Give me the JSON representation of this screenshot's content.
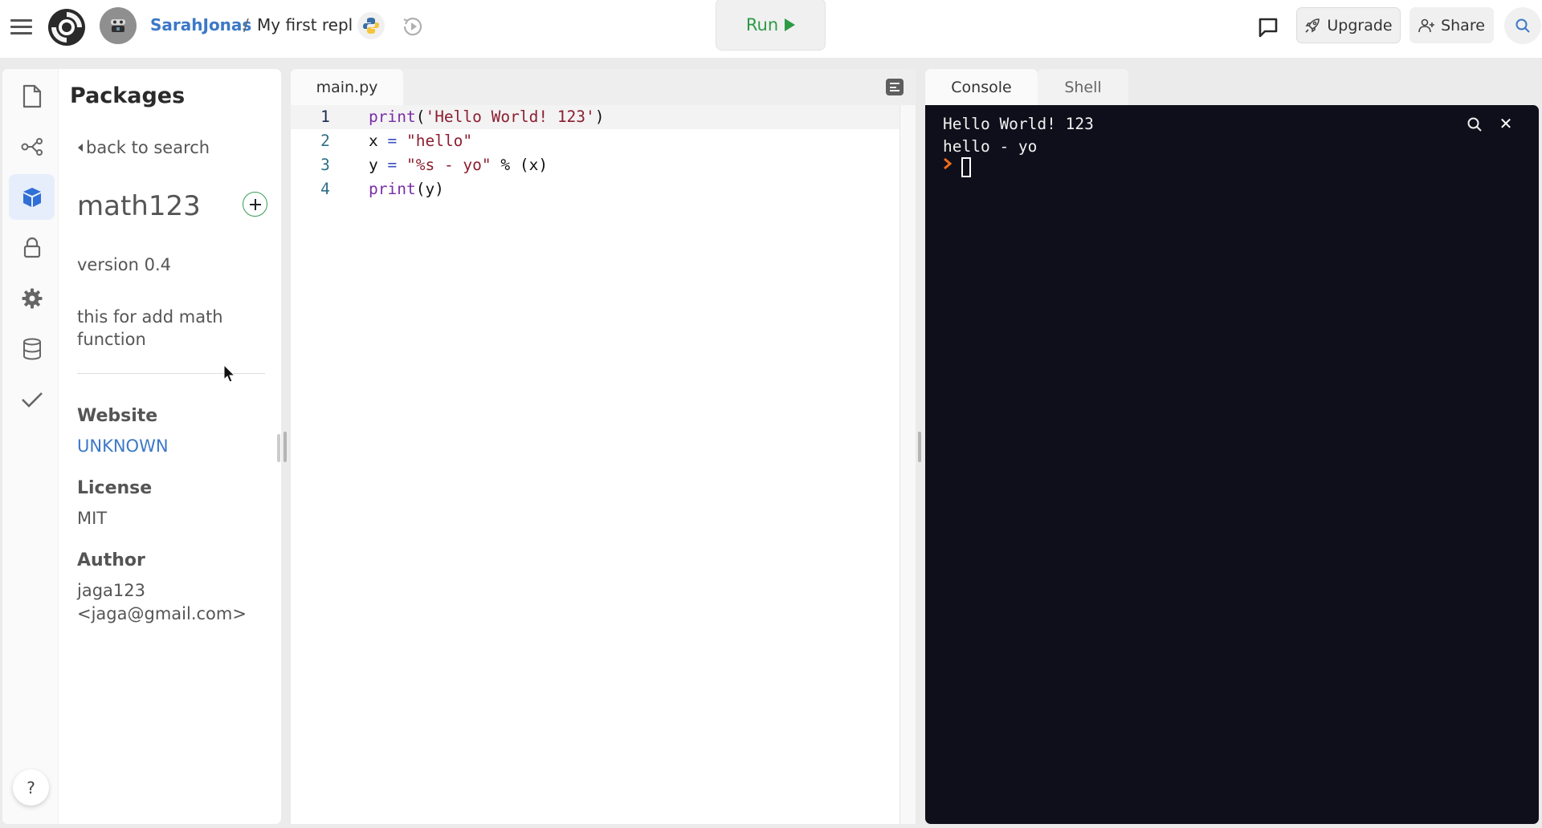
{
  "header": {
    "user": "SarahJonas",
    "separator": "/",
    "repl_name": "My first repl",
    "language_icon": "python-icon",
    "run_label": "Run",
    "upgrade_label": "Upgrade",
    "share_label": "Share"
  },
  "sidebar": {
    "items": [
      {
        "name": "files",
        "icon": "file-icon",
        "active": false
      },
      {
        "name": "version-control",
        "icon": "share-nodes-icon",
        "active": false
      },
      {
        "name": "packages",
        "icon": "cube-icon",
        "active": true
      },
      {
        "name": "secrets",
        "icon": "lock-icon",
        "active": false
      },
      {
        "name": "settings",
        "icon": "gear-icon",
        "active": false
      },
      {
        "name": "database",
        "icon": "database-icon",
        "active": false
      },
      {
        "name": "unit-tests",
        "icon": "check-icon",
        "active": false
      }
    ],
    "help_label": "?"
  },
  "packages": {
    "title": "Packages",
    "back_label": "back to search",
    "name": "math123",
    "version": "version 0.4",
    "description": "this for add math function",
    "website_label": "Website",
    "website_value": "UNKNOWN",
    "license_label": "License",
    "license_value": "MIT",
    "author_label": "Author",
    "author_name": "jaga123",
    "author_email": "<jaga@gmail.com>"
  },
  "editor": {
    "tab_label": "main.py",
    "lines": [
      {
        "number": "1",
        "tokens": [
          {
            "t": "print",
            "c": "kw"
          },
          {
            "t": "(",
            "c": ""
          },
          {
            "t": "'Hello World! 123'",
            "c": "str"
          },
          {
            "t": ")",
            "c": ""
          }
        ]
      },
      {
        "number": "2",
        "tokens": [
          {
            "t": "x ",
            "c": ""
          },
          {
            "t": "=",
            "c": "op"
          },
          {
            "t": " ",
            "c": ""
          },
          {
            "t": "\"hello\"",
            "c": "str"
          }
        ]
      },
      {
        "number": "3",
        "tokens": [
          {
            "t": "y ",
            "c": ""
          },
          {
            "t": "=",
            "c": "op"
          },
          {
            "t": " ",
            "c": ""
          },
          {
            "t": "\"%s - yo\"",
            "c": "str"
          },
          {
            "t": " % (x)",
            "c": ""
          }
        ]
      },
      {
        "number": "4",
        "tokens": [
          {
            "t": "print",
            "c": "kw"
          },
          {
            "t": "(y)",
            "c": ""
          }
        ]
      }
    ]
  },
  "console": {
    "tabs": [
      "Console",
      "Shell"
    ],
    "active_tab": "Console",
    "output": [
      "Hello World! 123",
      "hello - yo"
    ]
  },
  "colors": {
    "accent_blue": "#3c79c7",
    "run_green": "#2d9a45",
    "console_bg": "#0e0f1a",
    "prompt_orange": "#f26b1d"
  }
}
